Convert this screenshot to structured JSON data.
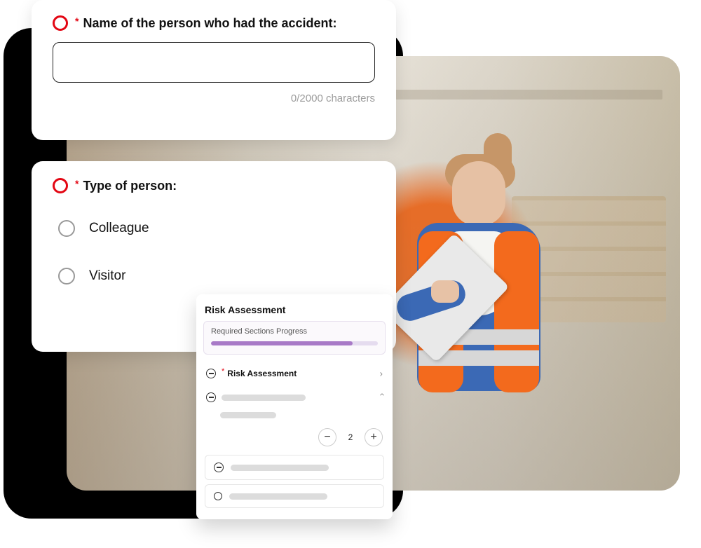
{
  "card1": {
    "question": "Name of the person who had the accident:",
    "input_value": "",
    "char_counter": "0/2000 characters"
  },
  "card2": {
    "question": "Type of person:",
    "options": [
      {
        "label": "Colleague"
      },
      {
        "label": "Visitor"
      }
    ]
  },
  "panel": {
    "title": "Risk Assessment",
    "progress_label": "Required Sections Progress",
    "section_label": "Risk Assessment",
    "stepper_value": "2"
  }
}
